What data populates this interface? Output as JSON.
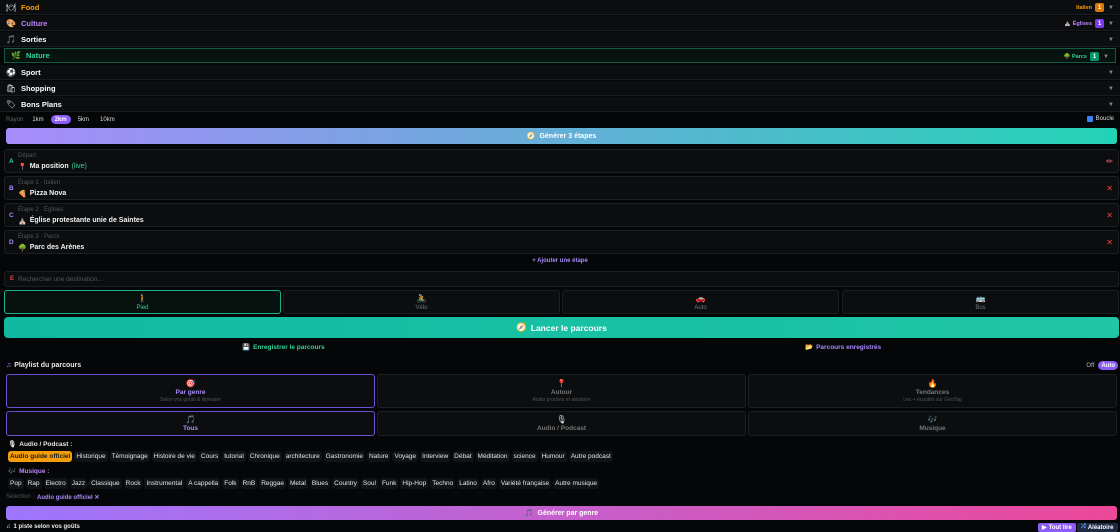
{
  "categories": [
    {
      "icon": "🍽",
      "label": "Food",
      "color": "#f59e0b",
      "tag": "Italien",
      "tag_color": "#f59e0b",
      "badge": "1",
      "badge_color": "#d97706"
    },
    {
      "icon": "🎨",
      "label": "Culture",
      "color": "#c084fc",
      "tag": "⛪ Églises",
      "tag_color": "#c084fc",
      "badge": "1",
      "badge_color": "#7c3aed"
    },
    {
      "icon": "🎵",
      "label": "Sorties",
      "color": "#ffffff",
      "tag": "",
      "badge": ""
    },
    {
      "icon": "🌿",
      "label": "Nature",
      "color": "#34d399",
      "tag": "🌳 Parcs",
      "tag_color": "#34d399",
      "badge": "1",
      "badge_color": "#059669"
    },
    {
      "icon": "⚽",
      "label": "Sport",
      "color": "#ffffff",
      "tag": "",
      "badge": ""
    },
    {
      "icon": "🛍",
      "label": "Shopping",
      "color": "#ffffff",
      "tag": "",
      "badge": ""
    },
    {
      "icon": "🏷",
      "label": "Bons Plans",
      "color": "#ffffff",
      "tag": "",
      "badge": ""
    }
  ],
  "radius": {
    "label": "Rayon",
    "options": [
      "1km",
      "2km",
      "5km",
      "10km"
    ],
    "selected": "2km",
    "loop_label": "Boucle"
  },
  "generate_steps_label": "Générer 3 étapes",
  "steps": [
    {
      "letter": "A",
      "letter_color": "#34d399",
      "sub": "Départ",
      "icon": "📍",
      "name": "Ma position",
      "extra": "(live)",
      "action": "edit"
    },
    {
      "letter": "B",
      "letter_color": "#a78bfa",
      "sub": "Étape 1 · Italien",
      "icon": "🍕",
      "name": "Pizza Nova",
      "extra": "",
      "action": "remove"
    },
    {
      "letter": "C",
      "letter_color": "#a78bfa",
      "sub": "Étape 2 · Églises",
      "icon": "⛪",
      "name": "Église protestante unie de Saintes",
      "extra": "",
      "action": "remove"
    },
    {
      "letter": "D",
      "letter_color": "#a78bfa",
      "sub": "Étape 3 · Parcs",
      "icon": "🌳",
      "name": "Parc des Arènes",
      "extra": "",
      "action": "remove"
    }
  ],
  "add_step_label": "+ Ajouter une étape",
  "destination": {
    "letter": "E",
    "placeholder": "Rechercher une destination..."
  },
  "modes": [
    {
      "icon": "🚶",
      "label": "Pied",
      "active": true
    },
    {
      "icon": "🚴",
      "label": "Vélo",
      "active": false
    },
    {
      "icon": "🚗",
      "label": "Auto",
      "active": false
    },
    {
      "icon": "🚌",
      "label": "Bus",
      "active": false
    }
  ],
  "launch_label": "Lancer le parcours",
  "save_route_label": "Enregistrer le parcours",
  "saved_routes_label": "Parcours enregistrés",
  "playlist": {
    "title": "Playlist du parcours",
    "toggle_off": "Off",
    "toggle_on": "Auto",
    "modes": [
      {
        "icon": "🎯",
        "title": "Par genre",
        "sub": "Selon vos goûts & itinéraire",
        "active": true
      },
      {
        "icon": "📍",
        "title": "Autour",
        "sub": "Audio proches et aléatoire",
        "active": false
      },
      {
        "icon": "🔥",
        "title": "Tendances",
        "sub": "Les + écoutés sur GeoTag",
        "active": false
      }
    ],
    "filters": [
      {
        "icon": "🎵",
        "title": "Tous",
        "active": true
      },
      {
        "icon": "🎙",
        "title": "Audio / Podcast",
        "active": false
      },
      {
        "icon": "🎶",
        "title": "Musique",
        "active": false
      }
    ],
    "audio_section_label": "Audio / Podcast :",
    "audio_chips": [
      "Audio guide officiel",
      "Historique",
      "Témoignage",
      "Histoire de vie",
      "Cours",
      "tutorial",
      "Chronique",
      "architecture",
      "Gastronomie",
      "Nature",
      "Voyage",
      "Interview",
      "Débat",
      "Méditation",
      "science",
      "Humour",
      "Autre podcast"
    ],
    "audio_selected": "Audio guide officiel",
    "music_section_label": "Musique :",
    "music_chips": [
      "Pop",
      "Rap",
      "Electro",
      "Jazz",
      "Classique",
      "Rock",
      "Instrumental",
      "A cappella",
      "Folk",
      "RnB",
      "Reggae",
      "Metal",
      "Blues",
      "Country",
      "Soul",
      "Funk",
      "Hip-Hop",
      "Techno",
      "Latino",
      "Afro",
      "Variété française",
      "Autre musique"
    ],
    "selection_label": "Sélection :",
    "selection_value": "Audio guide officiel ✕",
    "generate_label": "Générer par genre"
  },
  "footer": {
    "tracks_label": "1 piste selon vos goûts",
    "play_all_label": "Tout lire",
    "random_label": "Aléatoire"
  }
}
